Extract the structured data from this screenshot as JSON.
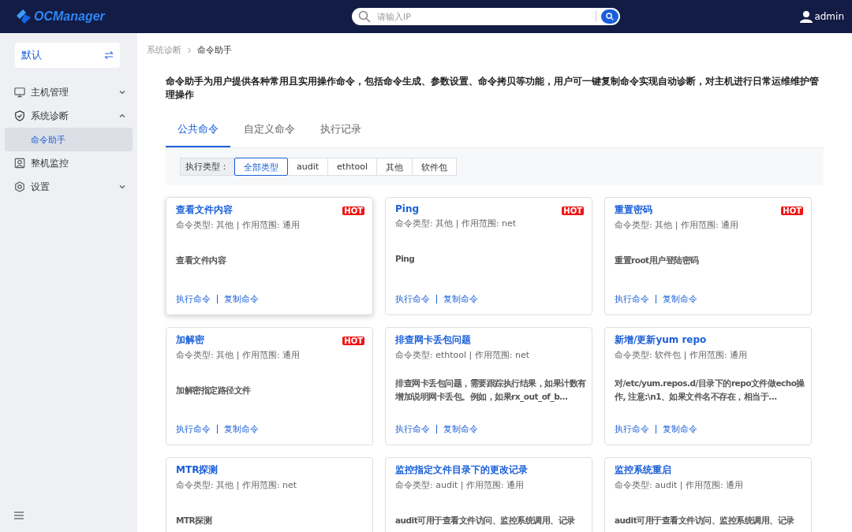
{
  "header": {
    "logo": "OCManager",
    "search": {
      "placeholder": "请输入IP"
    },
    "user": "admin"
  },
  "sidebar": {
    "workspace": "默认",
    "items": [
      {
        "kind": "group",
        "label": "主机管理",
        "expanded": false
      },
      {
        "kind": "group",
        "label": "系统诊断",
        "expanded": true,
        "children": [
          {
            "label": "命令助手",
            "selected": true
          }
        ]
      },
      {
        "kind": "link",
        "label": "整机监控",
        "selected": false
      },
      {
        "kind": "group",
        "label": "设置",
        "expanded": false
      }
    ]
  },
  "breadcrumb": [
    "系统诊断",
    "命令助手"
  ],
  "description": "命令助手为用户提供各种常用且实用操作命令，包括命令生成、参数设置、命令拷贝等功能，用户可一键复制命令实现自动诊断，对主机进行日常运维维护管理操作",
  "tabs": [
    {
      "label": "公共命令",
      "selected": true
    },
    {
      "label": "自定义命令",
      "selected": false
    },
    {
      "label": "执行记录",
      "selected": false
    }
  ],
  "filter": {
    "label": "执行类型：",
    "options": [
      {
        "label": "全部类型",
        "selected": true
      },
      {
        "label": "audit",
        "selected": false
      },
      {
        "label": "ethtool",
        "selected": false
      },
      {
        "label": "其他",
        "selected": false
      },
      {
        "label": "软件包",
        "selected": false
      }
    ]
  },
  "cards": [
    {
      "title": "查看文件内容",
      "meta": "命令类型: 其他 | 作用范围: 通用",
      "badge": "HOT",
      "hovered": true,
      "description": "查看文件内容",
      "actions": [
        "执行命令",
        "复制命令"
      ]
    },
    {
      "title": "Ping",
      "meta": "命令类型: 其他 | 作用范围: net",
      "badge": "HOT",
      "hovered": false,
      "description": "Ping",
      "actions": [
        "执行命令",
        "复制命令"
      ]
    },
    {
      "title": "重置密码",
      "meta": "命令类型: 其他 | 作用范围: 通用",
      "badge": "HOT",
      "hovered": false,
      "description": "重置root用户登陆密码",
      "actions": [
        "执行命令",
        "复制命令"
      ]
    },
    {
      "title": "加解密",
      "meta": "命令类型: 其他 | 作用范围: 通用",
      "badge": "HOT",
      "hovered": false,
      "description": "加解密指定路径文件",
      "actions": [
        "执行命令",
        "复制命令"
      ]
    },
    {
      "title": "排查网卡丢包问题",
      "meta": "命令类型: ethtool | 作用范围: net",
      "hovered": false,
      "description": "排查网卡丢包问题，需要跟踪执行结果，如果计数有增加说明网卡丢包。例如，如果rx_out_of_b…",
      "actions": [
        "执行命令",
        "复制命令"
      ]
    },
    {
      "title": "新增/更新yum repo",
      "meta": "命令类型: 软件包 | 作用范围: 通用",
      "hovered": false,
      "description": "对/etc/yum.repos.d/目录下的repo文件做echo操作, 注意:\\n1、如果文件名不存在，相当于…",
      "actions": [
        "执行命令",
        "复制命令"
      ]
    },
    {
      "title": "MTR探测",
      "meta": "命令类型: 其他 | 作用范围: net",
      "hovered": false,
      "description": "MTR探测"
    },
    {
      "title": "监控指定文件目录下的更改记录",
      "meta": "命令类型: audit | 作用范围: 通用",
      "hovered": false,
      "description": "audit可用于查看文件访问、监控系统调用、记录"
    },
    {
      "title": "监控系统重启",
      "meta": "命令类型: audit | 作用范围: 通用",
      "hovered": false,
      "description": "audit可用于查看文件访问、监控系统调用、记录"
    }
  ]
}
